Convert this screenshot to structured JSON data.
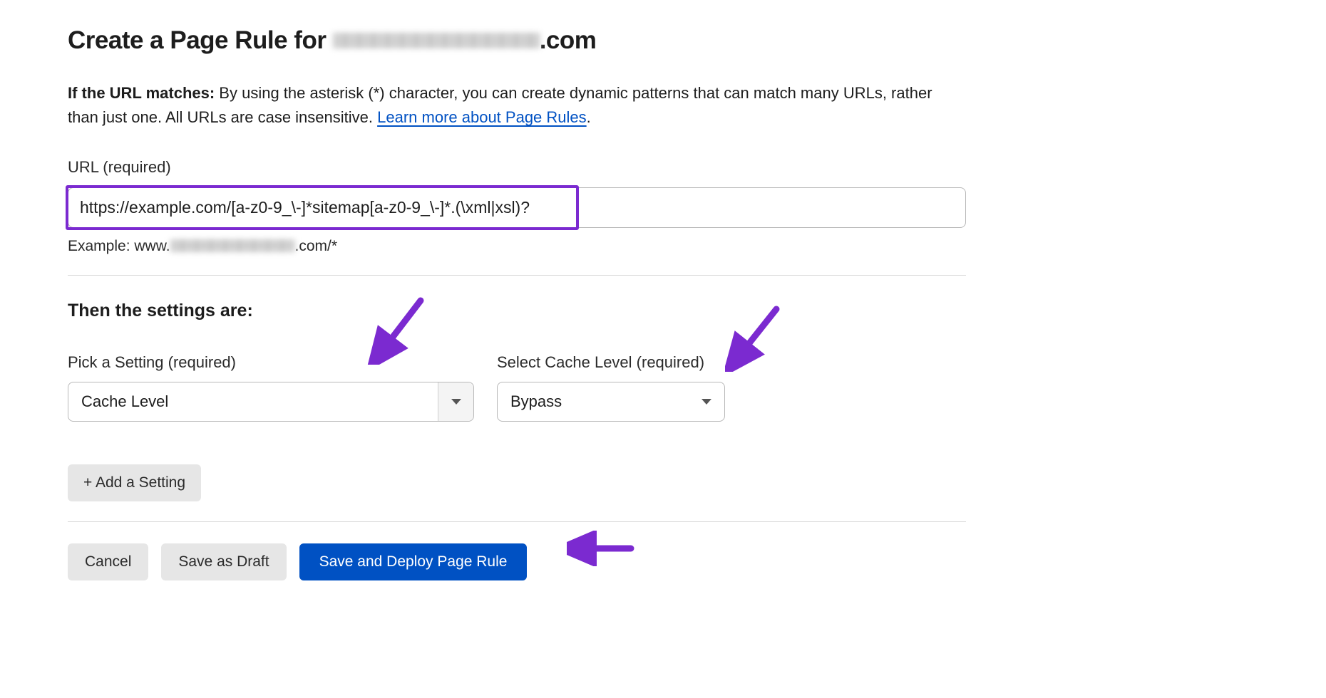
{
  "header": {
    "title_prefix": "Create a Page Rule for ",
    "domain_suffix": ".com"
  },
  "intro": {
    "bold": "If the URL matches:",
    "text": " By using the asterisk (*) character, you can create dynamic patterns that can match many URLs, rather than just one. All URLs are case insensitive. ",
    "link": "Learn more about Page Rules",
    "period": "."
  },
  "url_field": {
    "label": "URL (required)",
    "value": "https://example.com/[a-z0-9_\\-]*sitemap[a-z0-9_\\-]*.(\\xml|xsl)?",
    "example_prefix": "Example: www.",
    "example_suffix": ".com/*"
  },
  "settings": {
    "heading": "Then the settings are:",
    "pick_label": "Pick a Setting (required)",
    "pick_value": "Cache Level",
    "cache_label": "Select Cache Level (required)",
    "cache_value": "Bypass",
    "add_setting": "+ Add a Setting"
  },
  "footer": {
    "cancel": "Cancel",
    "save_draft": "Save as Draft",
    "save_deploy": "Save and Deploy Page Rule"
  },
  "colors": {
    "accent_purple": "#7b2ad0",
    "primary_blue": "#0051c3",
    "link_blue": "#0051c3"
  }
}
